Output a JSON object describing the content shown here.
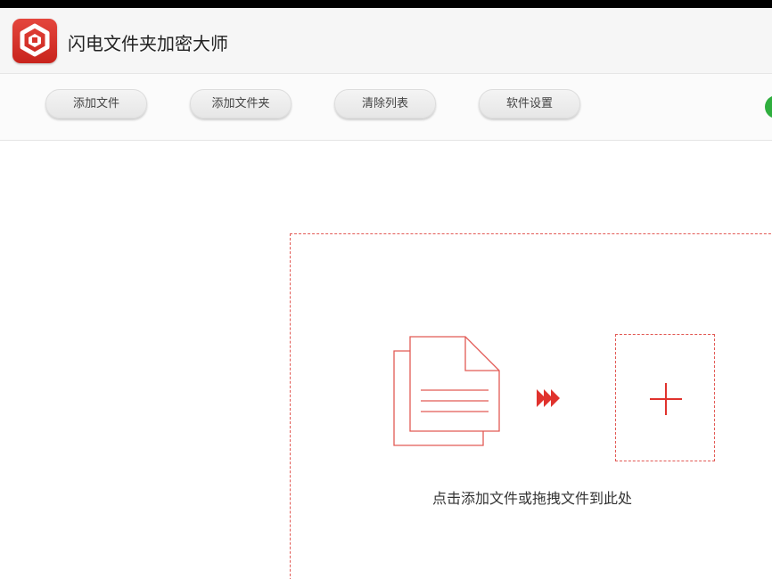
{
  "app": {
    "title": "闪电文件夹加密大师",
    "logo_icon": "shield-lock-icon",
    "accent_color": "#d8322b",
    "status_color": "#2fae3e"
  },
  "toolbar": {
    "add_file_label": "添加文件",
    "add_folder_label": "添加文件夹",
    "clear_list_label": "清除列表",
    "settings_label": "软件设置"
  },
  "drop_zone": {
    "hint": "点击添加文件或拖拽文件到此处",
    "icons": [
      "document-stack-icon",
      "triple-arrow-right-icon",
      "plus-icon"
    ]
  }
}
